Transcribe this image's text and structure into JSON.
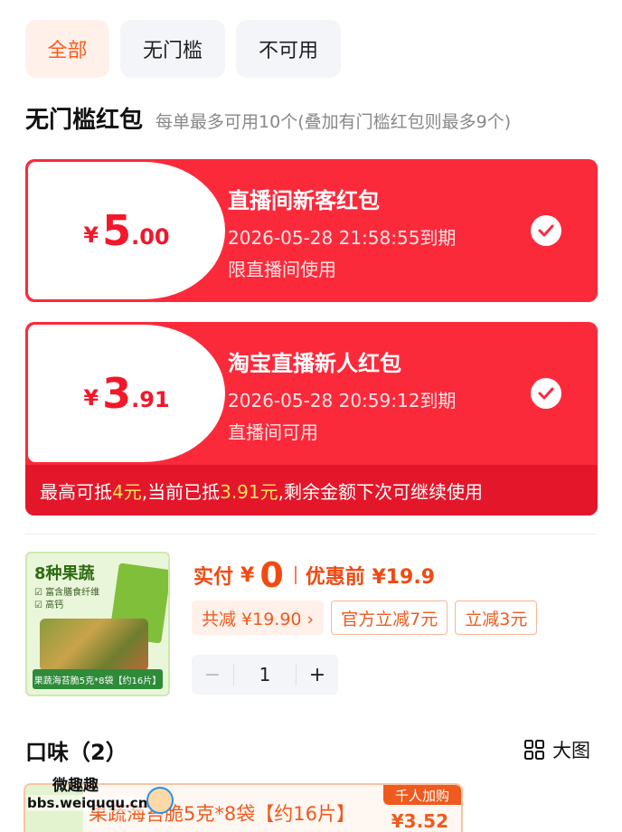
{
  "tabs": [
    {
      "label": "全部",
      "active": true
    },
    {
      "label": "无门槛",
      "active": false
    },
    {
      "label": "不可用",
      "active": false
    }
  ],
  "section": {
    "title": "无门槛红包",
    "subtitle": "每单最多可用10个(叠加有门槛红包则最多9个)"
  },
  "coupons": [
    {
      "currency": "¥",
      "amount_int": "5",
      "amount_dec": ".00",
      "name": "直播间新客红包",
      "expiry": "2026-05-28 21:58:55到期",
      "scope": "限直播间使用",
      "selected": true
    },
    {
      "currency": "¥",
      "amount_int": "3",
      "amount_dec": ".91",
      "name": "淘宝直播新人红包",
      "expiry": "2026-05-28 20:59:12到期",
      "scope": "直播间可用",
      "selected": true,
      "note_prefix": "最高可抵",
      "note_max": "4元",
      "note_mid": ",当前已抵",
      "note_used": "3.91元",
      "note_suffix": ",剩余金额下次可继续使用"
    }
  ],
  "product": {
    "thumb_title": "8种果蔬",
    "thumb_bullet1": "☑ 富含膳食纤维",
    "thumb_bullet2": "☑ 高钙",
    "thumb_footer": "果蔬海苔脆5克*8袋【约16片】",
    "pay_label": "实付",
    "pay_currency": "¥",
    "pay_amount": "0",
    "before_label": "优惠前 ¥19.9",
    "discount_total": "共减 ¥19.90 ›",
    "discount_official": "官方立减7元",
    "discount_extra": "立减3元",
    "quantity": "1",
    "minus": "−",
    "plus": "+"
  },
  "flavor": {
    "title": "口味（2）",
    "view_label": "大图",
    "option_text": "果蔬海苔脆5克*8袋【约16片】",
    "option_badge": "千人加购",
    "option_price": "¥3.52"
  },
  "watermark": {
    "line1": "微趣趣",
    "line2": "bbs.weiququ.cn"
  },
  "colors": {
    "coupon_red": "#fb2a3b",
    "accent_orange": "#f04a12",
    "tab_active": "#ff5a1f"
  }
}
